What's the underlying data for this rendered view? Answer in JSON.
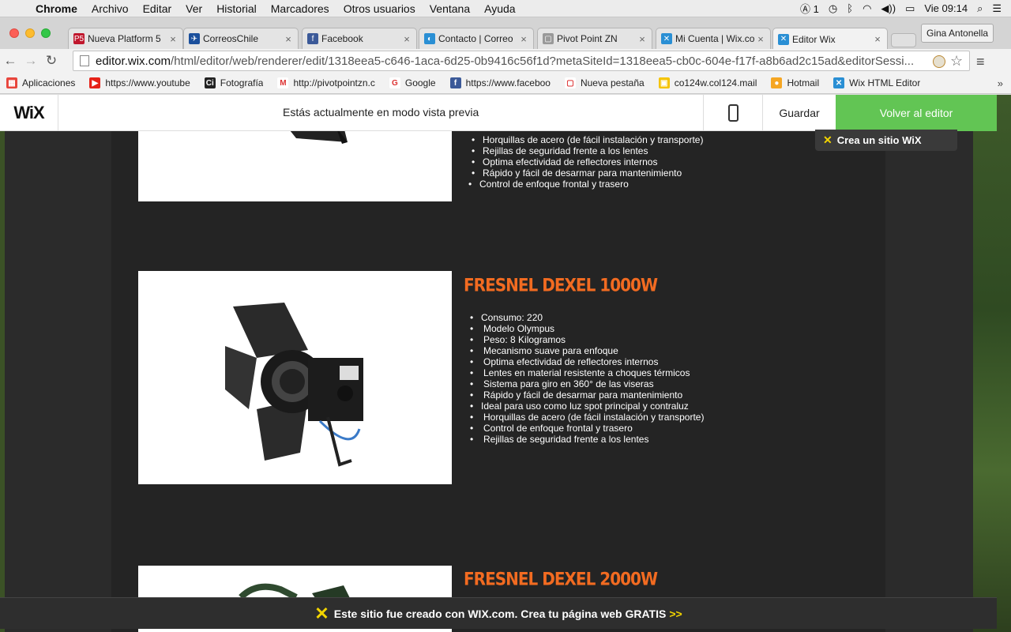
{
  "menubar": {
    "app": "Chrome",
    "items": [
      "Archivo",
      "Editar",
      "Ver",
      "Historial",
      "Marcadores",
      "Otros usuarios",
      "Ventana",
      "Ayuda"
    ],
    "status": {
      "adobe": "1",
      "clock": "Vie 09:14"
    }
  },
  "tabs": [
    {
      "title": "Nueva Platform 5",
      "favicon": "P5",
      "color": "#c0172d"
    },
    {
      "title": "CorreosChile",
      "favicon": "✈",
      "color": "#1a4f9c"
    },
    {
      "title": "Facebook",
      "favicon": "f",
      "color": "#3b5998"
    },
    {
      "title": "Contacto | Correo",
      "favicon": "◐",
      "color": "#2a8fd4"
    },
    {
      "title": "Pivot Point ZN",
      "favicon": "▢",
      "color": "#999999"
    },
    {
      "title": "Mi Cuenta | Wix.co",
      "favicon": "✕",
      "color": "#2a8fd4"
    },
    {
      "title": "Editor Wix",
      "favicon": "✕",
      "color": "#2a8fd4"
    }
  ],
  "profile": "Gina Antonella",
  "address": {
    "host": "editor.wix.com",
    "path": "/html/editor/web/renderer/edit/1318eea5-c646-1aca-6d25-0b9416c56f1d?metaSiteId=1318eea5-cb0c-604e-f17f-a8b6ad2c15ad&editorSessi..."
  },
  "bookmarks": [
    {
      "label": "Aplicaciones",
      "icon": "apps-icon"
    },
    {
      "label": "https://www.youtube",
      "icon": "youtube-icon"
    },
    {
      "label": "Fotografía",
      "icon": "camera-icon"
    },
    {
      "label": "http://pivotpointzn.c",
      "icon": "gmail-icon"
    },
    {
      "label": "Google",
      "icon": "google-icon"
    },
    {
      "label": "https://www.faceboo",
      "icon": "facebook-icon"
    },
    {
      "label": "Nueva pestaña",
      "icon": "page-icon"
    },
    {
      "label": "co124w.col124.mail",
      "icon": "mail-icon"
    },
    {
      "label": "Hotmail",
      "icon": "hotmail-icon"
    },
    {
      "label": "Wix HTML Editor",
      "icon": "wix-icon"
    }
  ],
  "wix": {
    "logo": "WiX",
    "preview_text": "Estás actualmente en modo vista previa",
    "save": "Guardar",
    "back": "Volver al editor",
    "crea": "Crea un sitio WiX"
  },
  "products": [
    {
      "title": "",
      "bullets": [
        "Horquillas de acero (de fácil instalación y transporte)",
        "Rejillas de seguridad frente a los lentes",
        "Optima efectividad de reflectores internos",
        "Rápido y fácil de desarmar para mantenimiento",
        "Control de enfoque frontal y trasero"
      ]
    },
    {
      "title": "FRESNEL DEXEL 1000W",
      "bullets": [
        "Consumo: 220",
        "Modelo Olympus",
        "Peso: 8 Kilogramos",
        "Mecanismo suave para enfoque",
        "Optima efectividad de reflectores internos",
        "Lentes en material resistente a choques térmicos",
        "Sistema para giro en 360° de las viseras",
        "Rápido y fácil de desarmar para mantenimiento",
        "Ideal para uso como luz spot principal y contraluz",
        "Horquillas de acero (de fácil instalación y transporte)",
        "Control de enfoque frontal y trasero",
        "Rejillas de seguridad frente a los lentes"
      ]
    },
    {
      "title": "FRESNEL DEXEL 2000W",
      "bullets": []
    }
  ],
  "footer": {
    "text": "Este sitio fue creado con WIX.com. Crea tu página web GRATIS",
    "arrows": ">>"
  },
  "colors": {
    "accent_green": "#62c554",
    "title_orange": "#f26b21",
    "wix_yellow": "#f2d400"
  }
}
